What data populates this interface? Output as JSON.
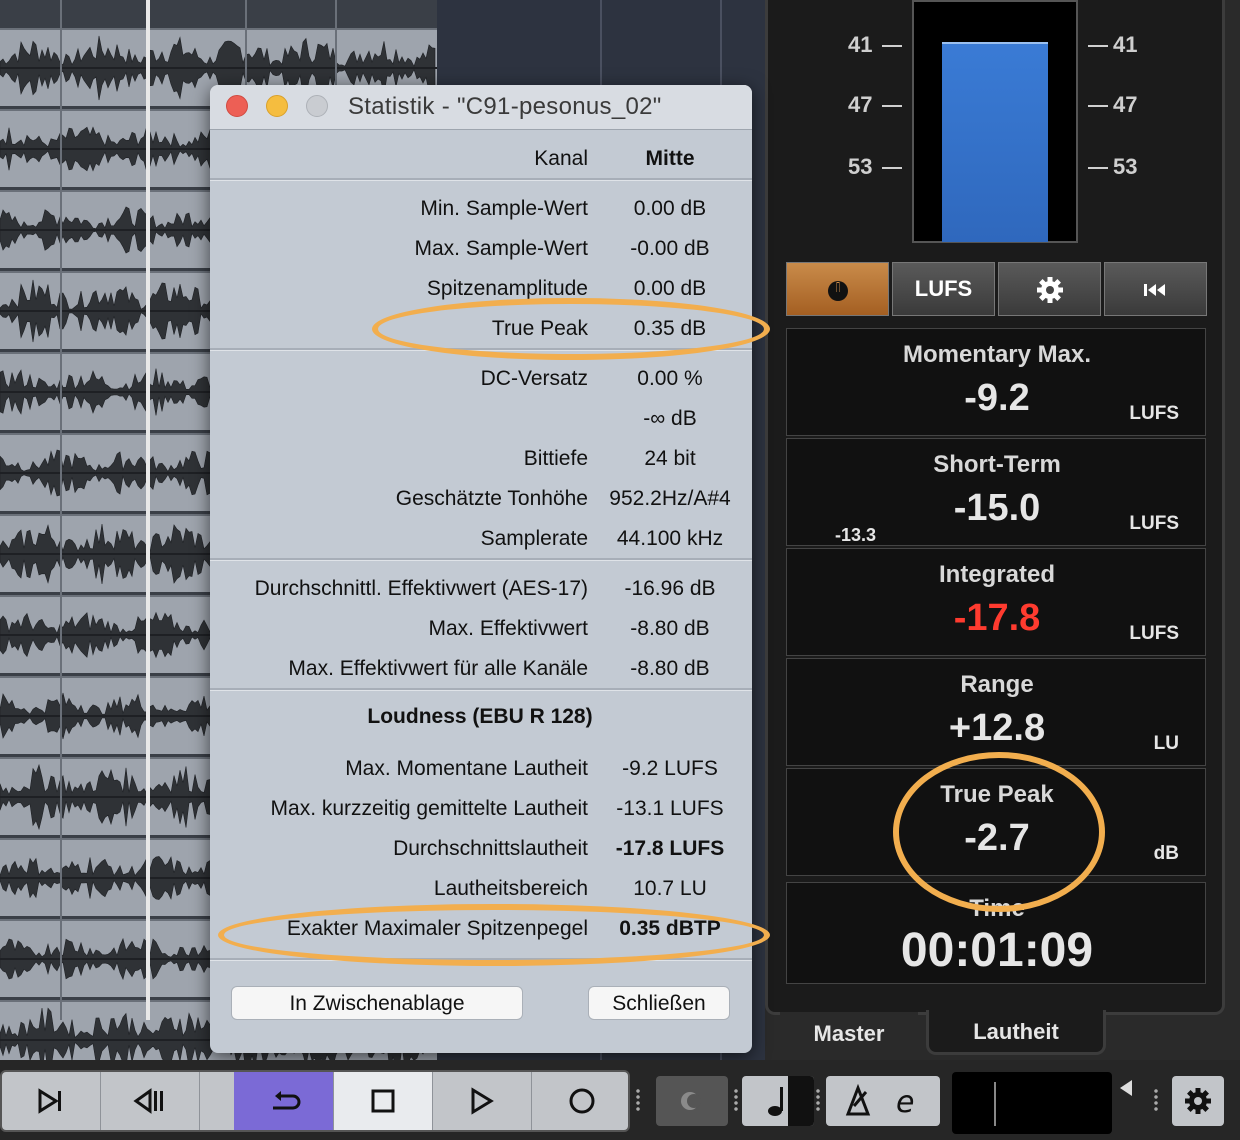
{
  "dialog": {
    "title": "Statistik - \"C91-pesonus_02\"",
    "header": {
      "label": "Kanal",
      "value": "Mitte"
    },
    "sections": [
      [
        {
          "label": "Min. Sample-Wert",
          "value": "0.00 dB"
        },
        {
          "label": "Max. Sample-Wert",
          "value": "-0.00 dB"
        },
        {
          "label": "Spitzenamplitude",
          "value": "0.00 dB"
        },
        {
          "label": "True Peak",
          "value": "0.35 dB"
        }
      ],
      [
        {
          "label": "DC-Versatz",
          "value": "0.00 %"
        },
        {
          "label": "",
          "value": "-∞ dB"
        },
        {
          "label": "Bittiefe",
          "value": "24 bit"
        },
        {
          "label": "Geschätzte Tonhöhe",
          "value": "952.2Hz/A#4"
        },
        {
          "label": "Samplerate",
          "value": "44.100 kHz"
        }
      ],
      [
        {
          "label": "Durchschnittl. Effektivwert (AES-17)",
          "value": "-16.96 dB"
        },
        {
          "label": "Max. Effektivwert",
          "value": "-8.80 dB"
        },
        {
          "label": "Max. Effektivwert für alle Kanäle",
          "value": "-8.80 dB"
        }
      ]
    ],
    "loudness_heading": "Loudness (EBU R 128)",
    "loudness": [
      {
        "label": "Max. Momentane Lautheit",
        "value": "-9.2 LUFS"
      },
      {
        "label": "Max. kurzzeitig gemittelte Lautheit",
        "value": "-13.1 LUFS"
      },
      {
        "label": "Durchschnittslautheit",
        "value": "-17.8 LUFS"
      },
      {
        "label": "Lautheitsbereich",
        "value": "10.7 LU"
      },
      {
        "label": "Exakter Maximaler Spitzenpegel",
        "value": "0.35 dBTP"
      }
    ],
    "buttons": {
      "copy": "In Zwischenablage",
      "close": "Schließen"
    }
  },
  "meter": {
    "scale": [
      "41",
      "47",
      "53"
    ],
    "controls": {
      "lufs": "LUFS"
    },
    "cells": [
      {
        "label": "Momentary Max.",
        "value": "-9.2",
        "unit": "LUFS"
      },
      {
        "label": "Short-Term",
        "value": "-15.0",
        "unit": "LUFS",
        "sub": "-13.3"
      },
      {
        "label": "Integrated",
        "value": "-17.8",
        "unit": "LUFS"
      },
      {
        "label": "Range",
        "value": "+12.8",
        "unit": "LU"
      },
      {
        "label": "True Peak",
        "value": "-2.7",
        "unit": "dB"
      }
    ],
    "time": {
      "label": "Time",
      "value": "00:01:09"
    },
    "tabs": {
      "master": "Master",
      "lautheit": "Lautheit"
    }
  },
  "colors": {
    "integrated_value": "#ff3b2f",
    "highlight_ring": "#f2ae4e",
    "meter_fill": "#3a7bd5",
    "cycle_active": "#7b6ad6"
  },
  "icons": [
    "power-icon",
    "gear-icon",
    "reset-icon",
    "skip-to-end-icon",
    "previous-marker-icon",
    "next-marker-icon",
    "cycle-icon",
    "stop-icon",
    "play-icon",
    "record-icon",
    "punch-icon",
    "metronome-note-icon",
    "tempo-icon",
    "settings-icon"
  ]
}
